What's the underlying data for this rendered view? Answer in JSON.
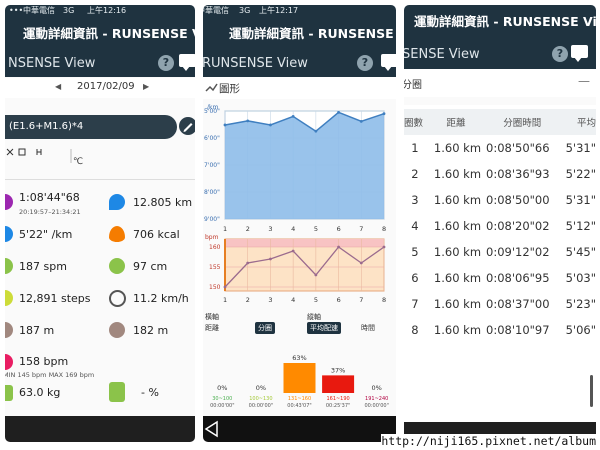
{
  "status_left": {
    "carrier": "中華電信",
    "net": "3G",
    "time": "上午12:16"
  },
  "status_mid": {
    "carrier": "中華電信",
    "net": "3G",
    "time": "上午12:17"
  },
  "app_title": "運動詳細資訊 - RUNSENSE View",
  "app_title_trunc": "運動詳細資訊 - RUNSENSE V",
  "runsense_left": "NSENSE View",
  "runsense_mid": "RUNSENSE View",
  "runsense_right": "SENSE View",
  "summary": {
    "date": "2017/02/09",
    "prev_arrow": "◀",
    "next_arrow": "▶",
    "workout": "(E1.6+M1.6)*4",
    "temp_unit": "℃",
    "metrics": [
      {
        "icon": "clock-icon",
        "value": "1:08'44\"68",
        "sub": "20:19:57–21:34:21"
      },
      {
        "icon": "location-pin-icon",
        "value": "12.805 km"
      },
      {
        "icon": "pace-icon",
        "value": "5'22\" /km"
      },
      {
        "icon": "flame-icon",
        "value": "706 kcal"
      },
      {
        "icon": "footprints-icon",
        "value": "187 spm"
      },
      {
        "icon": "stride-icon",
        "value": "97 cm"
      },
      {
        "icon": "shoe-icon",
        "value": "12,891 steps"
      },
      {
        "icon": "speedometer-icon",
        "value": "11.2 km/h"
      },
      {
        "icon": "ascent-icon",
        "value": "187 m"
      },
      {
        "icon": "descent-icon",
        "value": "182 m"
      },
      {
        "icon": "heart-icon",
        "value": "158 bpm",
        "sub": "MIN 145 bpm MAX 169 bpm"
      },
      {
        "icon": "weight-icon",
        "value": "63.0 kg"
      },
      {
        "icon": "body-fat-icon",
        "value": "- %"
      }
    ]
  },
  "graph": {
    "section_title": "圖形",
    "pace_unit": "/km",
    "hr_unit": "bpm",
    "x_axis_label": "橫軸",
    "y_axis_label": "縱軸",
    "x_opt_distance": "距離",
    "x_opt_lap": "分圈",
    "y_opt_pace": "平均配速",
    "y_opt_time": "時間",
    "zones": [
      {
        "pct": "0%",
        "range": "30~100",
        "time": "00:00'00\"",
        "color": "#4caf50"
      },
      {
        "pct": "0%",
        "range": "100~130",
        "time": "00:00'00\"",
        "color": "#a5c93a"
      },
      {
        "pct": "63%",
        "range": "131~160",
        "time": "00:43'07\"",
        "color": "#ff8a00"
      },
      {
        "pct": "37%",
        "range": "161~190",
        "time": "00:25'37\"",
        "color": "#e8190f"
      },
      {
        "pct": "0%",
        "range": "191~240",
        "time": "00:00'00\"",
        "color": "#b00040"
      }
    ]
  },
  "laps": {
    "section_title": "分圈",
    "headers": [
      "圈數",
      "距離",
      "分圈時間",
      "平均"
    ],
    "rows": [
      {
        "n": "1",
        "dist": "1.60 km",
        "time": "0:08'50\"66",
        "pace": "5'31\""
      },
      {
        "n": "2",
        "dist": "1.60 km",
        "time": "0:08'36\"93",
        "pace": "5'22\""
      },
      {
        "n": "3",
        "dist": "1.60 km",
        "time": "0:08'50\"00",
        "pace": "5'31\""
      },
      {
        "n": "4",
        "dist": "1.60 km",
        "time": "0:08'20\"02",
        "pace": "5'12\""
      },
      {
        "n": "5",
        "dist": "1.60 km",
        "time": "0:09'12\"02",
        "pace": "5'45\""
      },
      {
        "n": "6",
        "dist": "1.60 km",
        "time": "0:08'06\"95",
        "pace": "5'03\""
      },
      {
        "n": "7",
        "dist": "1.60 km",
        "time": "0:08'37\"00",
        "pace": "5'23\""
      },
      {
        "n": "8",
        "dist": "1.60 km",
        "time": "0:08'10\"97",
        "pace": "5'06\""
      }
    ]
  },
  "watermark": "http://niji165.pixnet.net/album",
  "chart_data": [
    {
      "type": "area",
      "x": [
        1,
        2,
        3,
        4,
        5,
        6,
        7,
        8
      ],
      "series": [
        {
          "values": [
            331,
            322,
            331,
            312,
            345,
            303,
            323,
            306
          ]
        }
      ],
      "ylabel": "/km",
      "y_tick_labels": [
        "5'00\"",
        "6'00\"",
        "7'00\"",
        "8'00\"",
        "9'00\""
      ],
      "ylim": [
        300,
        540
      ],
      "y_inverted": true,
      "grid": true
    },
    {
      "type": "line",
      "x": [
        1,
        2,
        3,
        4,
        5,
        6,
        7,
        8
      ],
      "series": [
        {
          "values": [
            150,
            156,
            157,
            159,
            153,
            160,
            156,
            160
          ]
        }
      ],
      "ylabel": "bpm",
      "y_ticks": [
        150,
        155,
        160
      ],
      "ylim": [
        149,
        162
      ],
      "grid": true
    }
  ]
}
